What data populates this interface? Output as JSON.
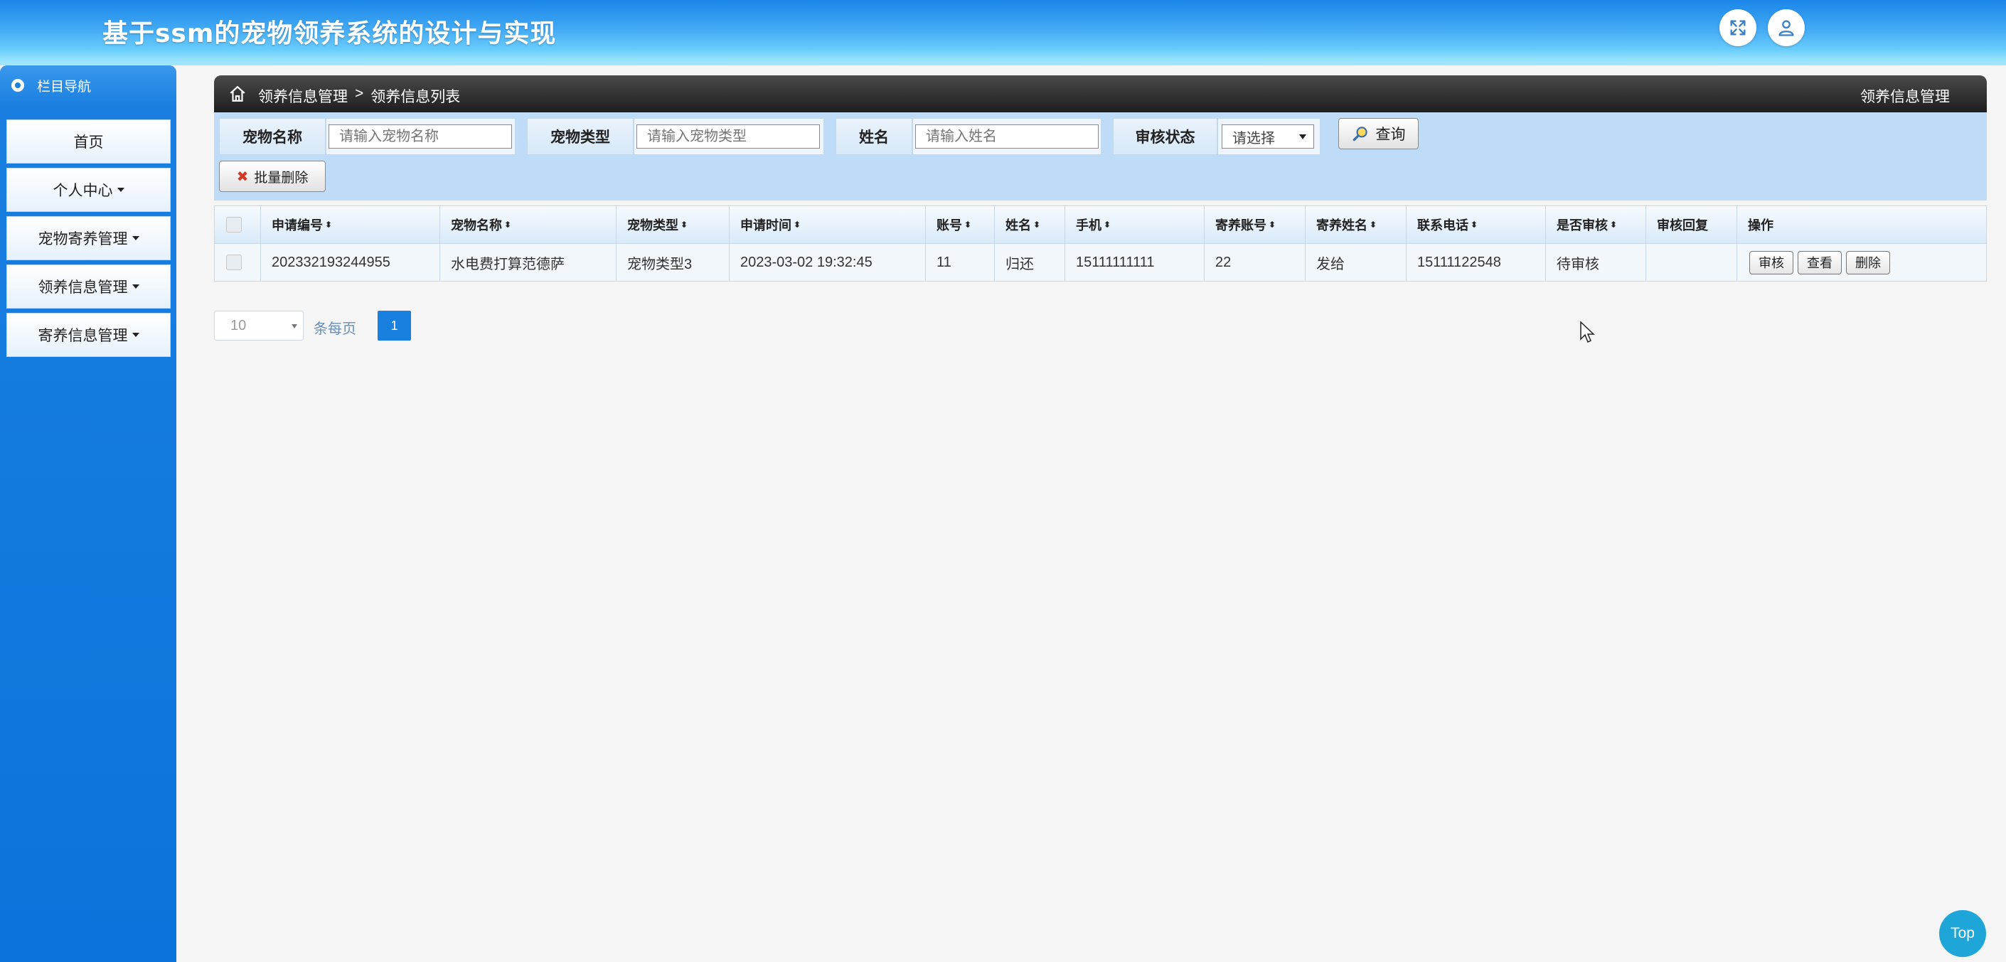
{
  "header": {
    "title": "基于ssm的宠物领养系统的设计与实现",
    "fullscreen_icon": "expand-arrows-icon",
    "user_icon": "user-icon"
  },
  "sidebar": {
    "nav_title": "栏目导航",
    "items": [
      {
        "label": "首页",
        "has_caret": false
      },
      {
        "label": "个人中心",
        "has_caret": true
      },
      {
        "label": "宠物寄养管理",
        "has_caret": true
      },
      {
        "label": "领养信息管理",
        "has_caret": true
      },
      {
        "label": "寄养信息管理",
        "has_caret": true
      }
    ]
  },
  "breadcrumb": {
    "home_icon": "home-icon",
    "parent": "领养信息管理",
    "separator": ">",
    "current": "领养信息列表",
    "right_title": "领养信息管理"
  },
  "search": {
    "pet_name_label": "宠物名称",
    "pet_name_placeholder": "请输入宠物名称",
    "pet_type_label": "宠物类型",
    "pet_type_placeholder": "请输入宠物类型",
    "name_label": "姓名",
    "name_placeholder": "请输入姓名",
    "audit_label": "审核状态",
    "audit_selected": "请选择",
    "query_button": "查询",
    "batch_delete_button": "批量删除"
  },
  "table": {
    "columns": [
      "申请编号",
      "宠物名称",
      "宠物类型",
      "申请时间",
      "账号",
      "姓名",
      "手机",
      "寄养账号",
      "寄养姓名",
      "联系电话",
      "是否审核",
      "审核回复",
      "操作"
    ],
    "sortable": [
      true,
      true,
      true,
      true,
      true,
      true,
      true,
      true,
      true,
      true,
      true,
      false,
      false
    ],
    "rows": [
      {
        "cells": [
          "202332193244955",
          "水电费打算范德萨",
          "宠物类型3",
          "2023-03-02 19:32:45",
          "11",
          "归还",
          "15111111111",
          "22",
          "发给",
          "15111122548",
          "待审核",
          ""
        ],
        "actions": [
          "审核",
          "查看",
          "删除"
        ]
      }
    ]
  },
  "pagination": {
    "page_size": "10",
    "per_page_label": "条每页",
    "current_page": "1"
  },
  "back_to_top": "Top",
  "colors": {
    "header_blue": "#1a86e8",
    "sidebar_blue": "#0a74dc",
    "active_page": "#1a80e0",
    "top_button": "#1fa6d8"
  }
}
